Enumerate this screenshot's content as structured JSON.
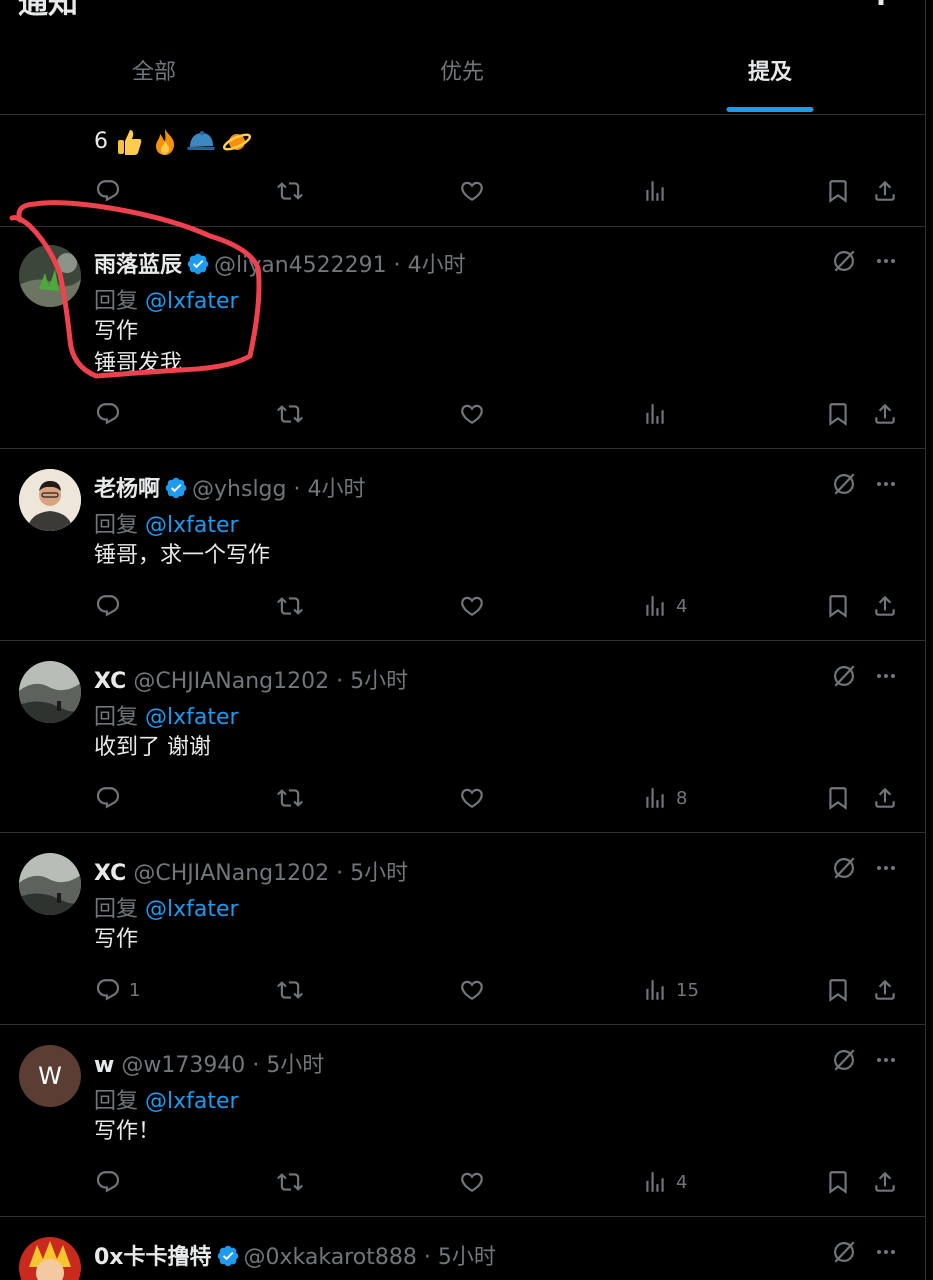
{
  "header": {
    "title": "通知",
    "more": "⋮"
  },
  "tabs": [
    {
      "label": "全部",
      "active": false
    },
    {
      "label": "优先",
      "active": false
    },
    {
      "label": "提及",
      "active": true
    }
  ],
  "partial_post": {
    "text": "6",
    "emojis": [
      "thumbs-up",
      "fire",
      "blue-cap",
      "ringed-planet"
    ]
  },
  "posts": [
    {
      "name": "雨落蓝辰",
      "verified": true,
      "handle": "@liyan4522291",
      "time": "4小时",
      "reply_prefix": "回复",
      "reply_to": "@lxfater",
      "lines": [
        "写作",
        "锤哥发我"
      ],
      "replies": "",
      "views": ""
    },
    {
      "name": "老杨啊",
      "verified": true,
      "handle": "@yhslgg",
      "time": "4小时",
      "reply_prefix": "回复",
      "reply_to": "@lxfater",
      "lines": [
        "锤哥，求一个写作"
      ],
      "replies": "",
      "views": "4"
    },
    {
      "name": "XC",
      "verified": false,
      "handle": "@CHJIANang1202",
      "time": "5小时",
      "reply_prefix": "回复",
      "reply_to": "@lxfater",
      "lines": [
        "收到了 谢谢"
      ],
      "replies": "",
      "views": "8"
    },
    {
      "name": "XC",
      "verified": false,
      "handle": "@CHJIANang1202",
      "time": "5小时",
      "reply_prefix": "回复",
      "reply_to": "@lxfater",
      "lines": [
        "写作"
      ],
      "replies": "1",
      "views": "15"
    },
    {
      "name": "w",
      "verified": false,
      "handle": "@w173940",
      "time": "5小时",
      "reply_prefix": "回复",
      "reply_to": "@lxfater",
      "lines": [
        "写作！"
      ],
      "replies": "",
      "views": "4",
      "avatar_letter": "W"
    },
    {
      "name": "0x卡卡撸特",
      "verified": true,
      "handle": "@0xkakarot888",
      "time": "5小时"
    }
  ],
  "separator": "·",
  "colors": {
    "accent": "#1d9bf0",
    "annotation": "#f0414e",
    "muted": "#71767b"
  }
}
